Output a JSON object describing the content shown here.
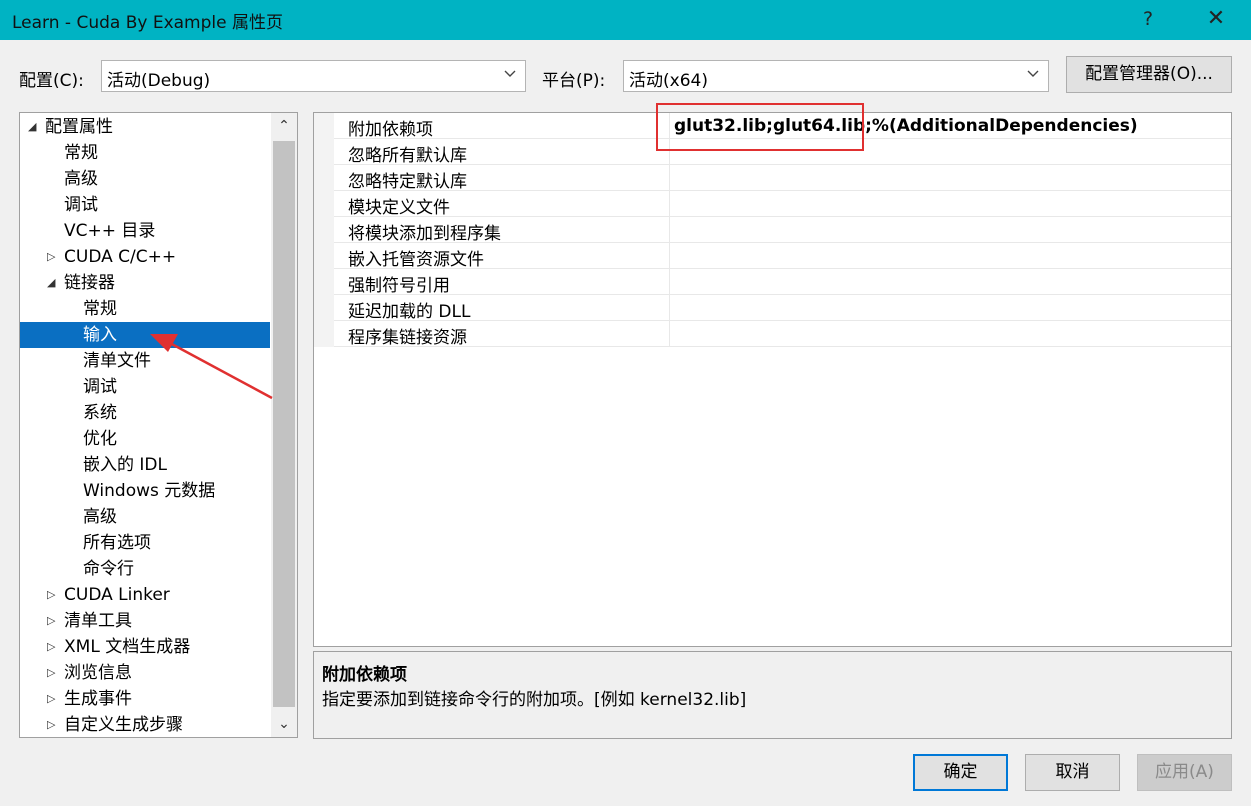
{
  "window": {
    "title": "Learn - Cuda By Example 属性页",
    "help": "?",
    "close": "✕"
  },
  "toolbar": {
    "config_label": "配置(C):",
    "config_value": "活动(Debug)",
    "platform_label": "平台(P):",
    "platform_value": "活动(x64)",
    "manager_button": "配置管理器(O)..."
  },
  "tree": [
    {
      "label": "配置属性",
      "expander": "◢",
      "level": 0
    },
    {
      "label": "常规",
      "expander": "",
      "level": 1
    },
    {
      "label": "高级",
      "expander": "",
      "level": 1
    },
    {
      "label": "调试",
      "expander": "",
      "level": 1
    },
    {
      "label": "VC++ 目录",
      "expander": "",
      "level": 1
    },
    {
      "label": "CUDA C/C++",
      "expander": "▷",
      "level": 1
    },
    {
      "label": "链接器",
      "expander": "◢",
      "level": 1
    },
    {
      "label": "常规",
      "expander": "",
      "level": 2
    },
    {
      "label": "输入",
      "expander": "",
      "level": 2,
      "selected": true
    },
    {
      "label": "清单文件",
      "expander": "",
      "level": 2
    },
    {
      "label": "调试",
      "expander": "",
      "level": 2
    },
    {
      "label": "系统",
      "expander": "",
      "level": 2
    },
    {
      "label": "优化",
      "expander": "",
      "level": 2
    },
    {
      "label": "嵌入的 IDL",
      "expander": "",
      "level": 2
    },
    {
      "label": "Windows 元数据",
      "expander": "",
      "level": 2
    },
    {
      "label": "高级",
      "expander": "",
      "level": 2
    },
    {
      "label": "所有选项",
      "expander": "",
      "level": 2
    },
    {
      "label": "命令行",
      "expander": "",
      "level": 2
    },
    {
      "label": "CUDA Linker",
      "expander": "▷",
      "level": 1
    },
    {
      "label": "清单工具",
      "expander": "▷",
      "level": 1
    },
    {
      "label": "XML 文档生成器",
      "expander": "▷",
      "level": 1
    },
    {
      "label": "浏览信息",
      "expander": "▷",
      "level": 1
    },
    {
      "label": "生成事件",
      "expander": "▷",
      "level": 1
    },
    {
      "label": "自定义生成步骤",
      "expander": "▷",
      "level": 1
    }
  ],
  "properties": [
    {
      "name": "附加依赖项",
      "value": "glut32.lib;glut64.lib;%(AdditionalDependencies)"
    },
    {
      "name": "忽略所有默认库",
      "value": ""
    },
    {
      "name": "忽略特定默认库",
      "value": ""
    },
    {
      "name": "模块定义文件",
      "value": ""
    },
    {
      "name": "将模块添加到程序集",
      "value": ""
    },
    {
      "name": "嵌入托管资源文件",
      "value": ""
    },
    {
      "name": "强制符号引用",
      "value": ""
    },
    {
      "name": "延迟加载的 DLL",
      "value": ""
    },
    {
      "name": "程序集链接资源",
      "value": ""
    }
  ],
  "description": {
    "title": "附加依赖项",
    "text": "指定要添加到链接命令行的附加项。[例如 kernel32.lib]"
  },
  "buttons": {
    "ok": "确定",
    "cancel": "取消",
    "apply": "应用(A)"
  },
  "colors": {
    "titlebar": "#00b3c3",
    "selection": "#0a6fc2",
    "annotation": "#e03030"
  }
}
